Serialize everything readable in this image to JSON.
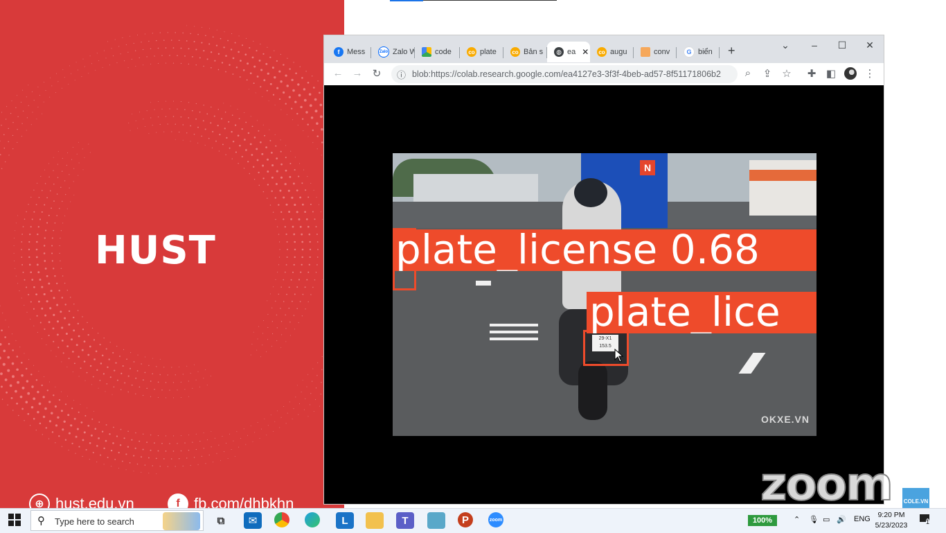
{
  "slide": {
    "logo": "HUST",
    "website": "hust.edu.vn",
    "facebook": "fb.com/dhbkhn",
    "bg_color": "#d83a3a"
  },
  "browser": {
    "tabs": [
      {
        "label": "Mess",
        "icon": "facebook-icon"
      },
      {
        "label": "Zalo W",
        "icon": "zalo-icon"
      },
      {
        "label": "code",
        "icon": "google-drive-icon"
      },
      {
        "label": "plate",
        "icon": "colab-icon"
      },
      {
        "label": "Bản s",
        "icon": "colab-icon"
      },
      {
        "label": "ea",
        "icon": "globe-icon",
        "active": true
      },
      {
        "label": "augu",
        "icon": "colab-icon"
      },
      {
        "label": "conv",
        "icon": "roboflow-icon"
      },
      {
        "label": "biển",
        "icon": "google-icon"
      }
    ],
    "url": "blob:https://colab.research.google.com/ea4127e3-3f3f-4beb-ad57-8f51171806b2"
  },
  "video": {
    "detections": [
      {
        "label": "plate_license 0.68"
      },
      {
        "label": "plate_lice"
      }
    ],
    "watermark": "OKXE.VN",
    "plate_text": "29-X1 153.5"
  },
  "overlay": {
    "zoom": "zoom",
    "badge": "COLE.VN"
  },
  "taskbar": {
    "search_placeholder": "Type here to search",
    "apps": [
      "task-view-icon",
      "mail-icon",
      "chrome-icon",
      "edge-icon",
      "lync-icon",
      "file-explorer-icon",
      "teams-icon",
      "app-icon",
      "powerpoint-icon",
      "zoom-icon"
    ],
    "battery": "100%",
    "language": "ENG",
    "time": "9:20 PM",
    "date": "5/23/2023",
    "notifications": "1"
  }
}
